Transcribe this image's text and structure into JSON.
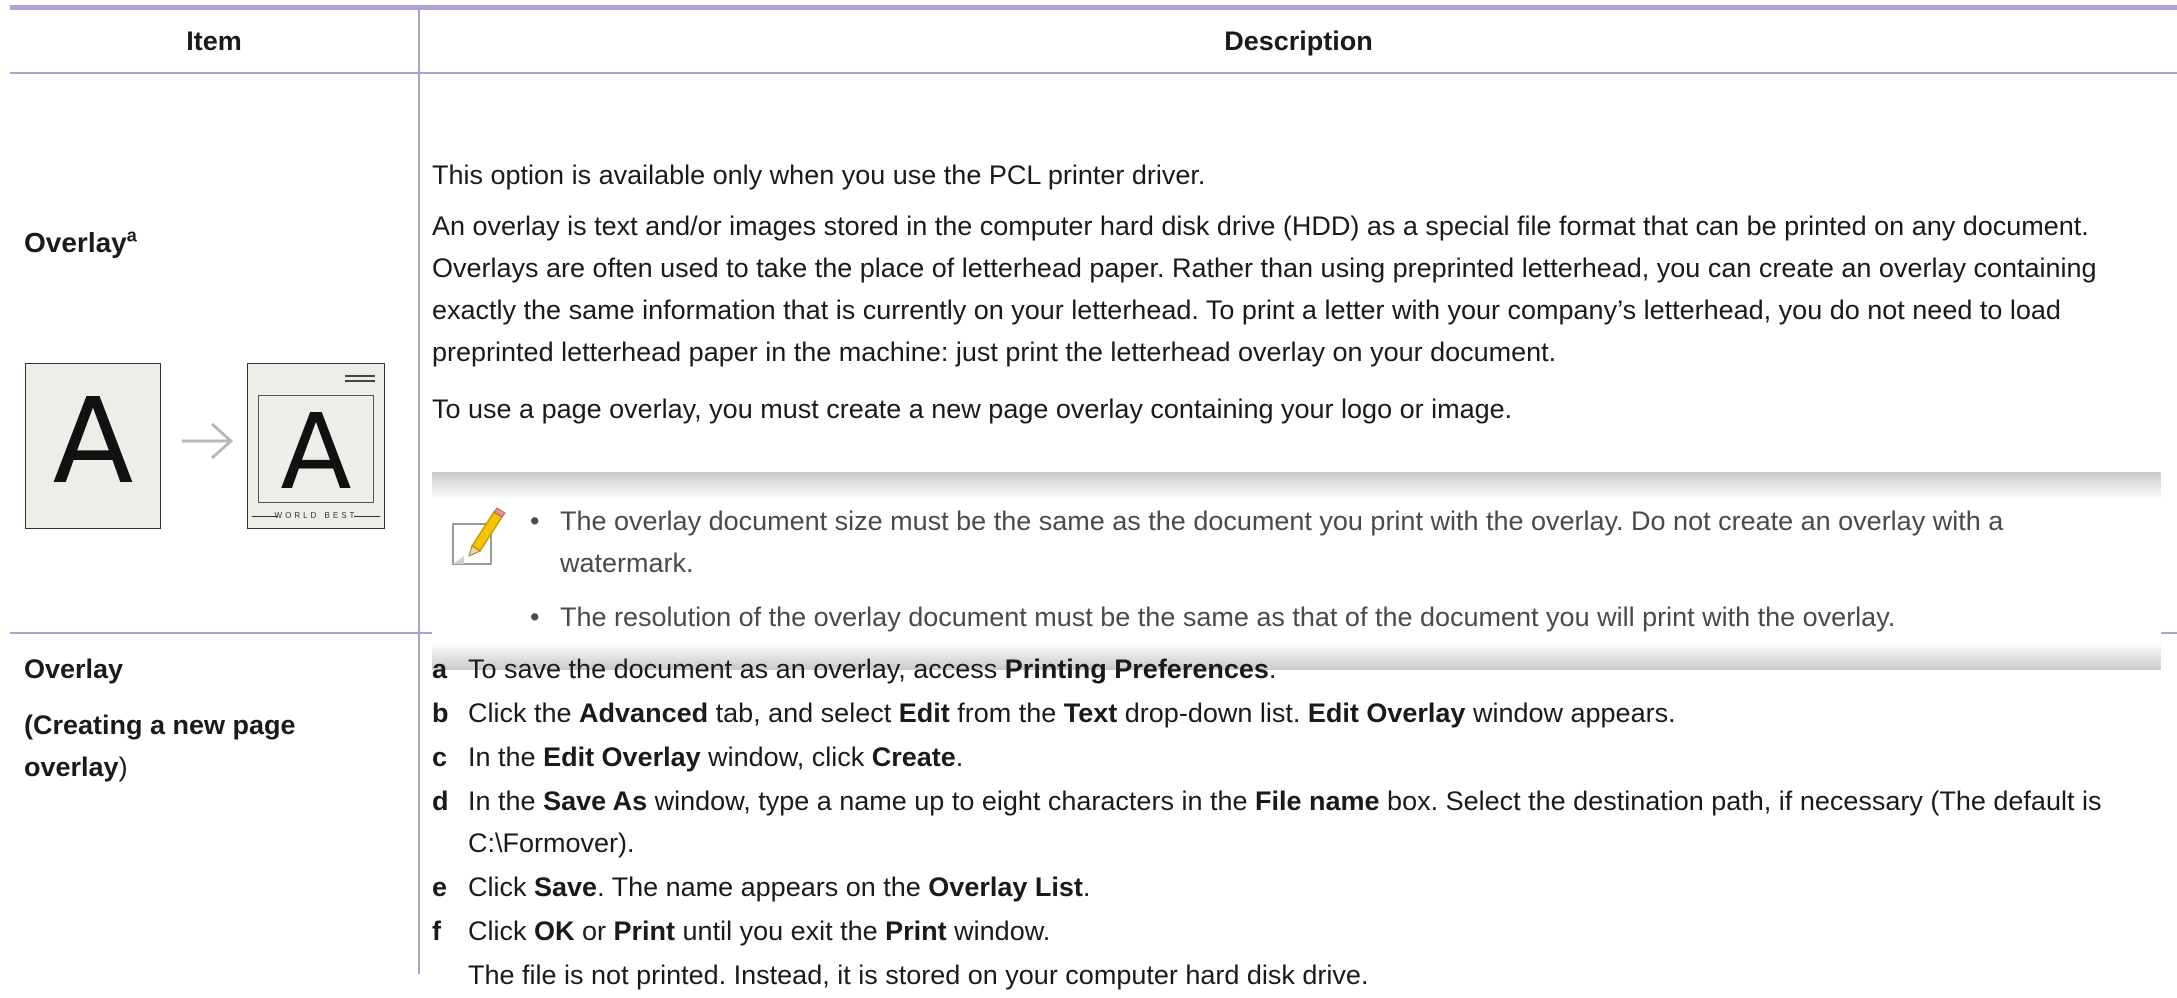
{
  "header": {
    "item_label": "Item",
    "description_label": "Description"
  },
  "overlay_row": {
    "item_title": "Overlay",
    "item_sup": "a",
    "illustration": {
      "letter": "A",
      "footer_text": "WORLD BEST"
    },
    "paragraphs": [
      "This option is available only when you use the PCL printer driver.",
      "An overlay is text and/or images stored in the computer hard disk drive (HDD) as a special file format that can be printed on any document. Overlays are often used to take the place of letterhead paper. Rather than using preprinted letterhead, you can create an overlay containing exactly the same information that is currently on your letterhead. To print a letter with your company’s letterhead, you do not need to load preprinted letterhead paper in the machine: just print the letterhead overlay on your document.",
      "To use a page overlay, you must create a new page overlay containing your logo or image."
    ],
    "note": {
      "icon": "note-pencil-icon",
      "bullet": "•",
      "items": [
        "The overlay document size must be the same as the document you print with the overlay. Do not create an overlay with a watermark.",
        "The resolution of the overlay document must be the same as that of the document you will print with the overlay."
      ]
    }
  },
  "create_row": {
    "item_title": "Overlay",
    "item_sub_open": "(",
    "item_sub_bold": "Creating a new page overlay",
    "item_sub_close": ")",
    "steps": [
      {
        "label": "a",
        "parts": [
          [
            "t",
            "To save the document as an overlay, access "
          ],
          [
            "b",
            "Printing Preferences"
          ],
          [
            "t",
            "."
          ]
        ]
      },
      {
        "label": "b",
        "parts": [
          [
            "t",
            "Click the "
          ],
          [
            "b",
            "Advanced"
          ],
          [
            "t",
            " tab, and select "
          ],
          [
            "b",
            "Edit"
          ],
          [
            "t",
            " from the "
          ],
          [
            "b",
            "Text"
          ],
          [
            "t",
            " drop-down list. "
          ],
          [
            "b",
            "Edit Overlay"
          ],
          [
            "t",
            " window appears."
          ]
        ]
      },
      {
        "label": "c",
        "parts": [
          [
            "t",
            "In the "
          ],
          [
            "b",
            "Edit Overlay"
          ],
          [
            "t",
            " window, click "
          ],
          [
            "b",
            "Create"
          ],
          [
            "t",
            "."
          ]
        ]
      },
      {
        "label": "d",
        "parts": [
          [
            "t",
            "In the "
          ],
          [
            "b",
            "Save As"
          ],
          [
            "t",
            " window, type a name up to eight characters in the "
          ],
          [
            "b",
            "File name"
          ],
          [
            "t",
            " box. Select the destination path, if necessary (The default is C:\\Formover)."
          ]
        ]
      },
      {
        "label": "e",
        "parts": [
          [
            "t",
            "Click "
          ],
          [
            "b",
            "Save"
          ],
          [
            "t",
            ". The name appears on the "
          ],
          [
            "b",
            "Overlay List"
          ],
          [
            "t",
            "."
          ]
        ]
      },
      {
        "label": "f",
        "parts": [
          [
            "t",
            "Click "
          ],
          [
            "b",
            "OK"
          ],
          [
            "t",
            " or "
          ],
          [
            "b",
            "Print"
          ],
          [
            "t",
            " until you exit the "
          ],
          [
            "b",
            "Print"
          ],
          [
            "t",
            " window."
          ]
        ]
      }
    ],
    "trailing_text": "The file is not printed. Instead, it is stored on your computer hard disk drive."
  },
  "colors": {
    "rule": "#a8a5d6",
    "note_text": "#4a4a4a",
    "note_shade": "#c9c9c9"
  }
}
